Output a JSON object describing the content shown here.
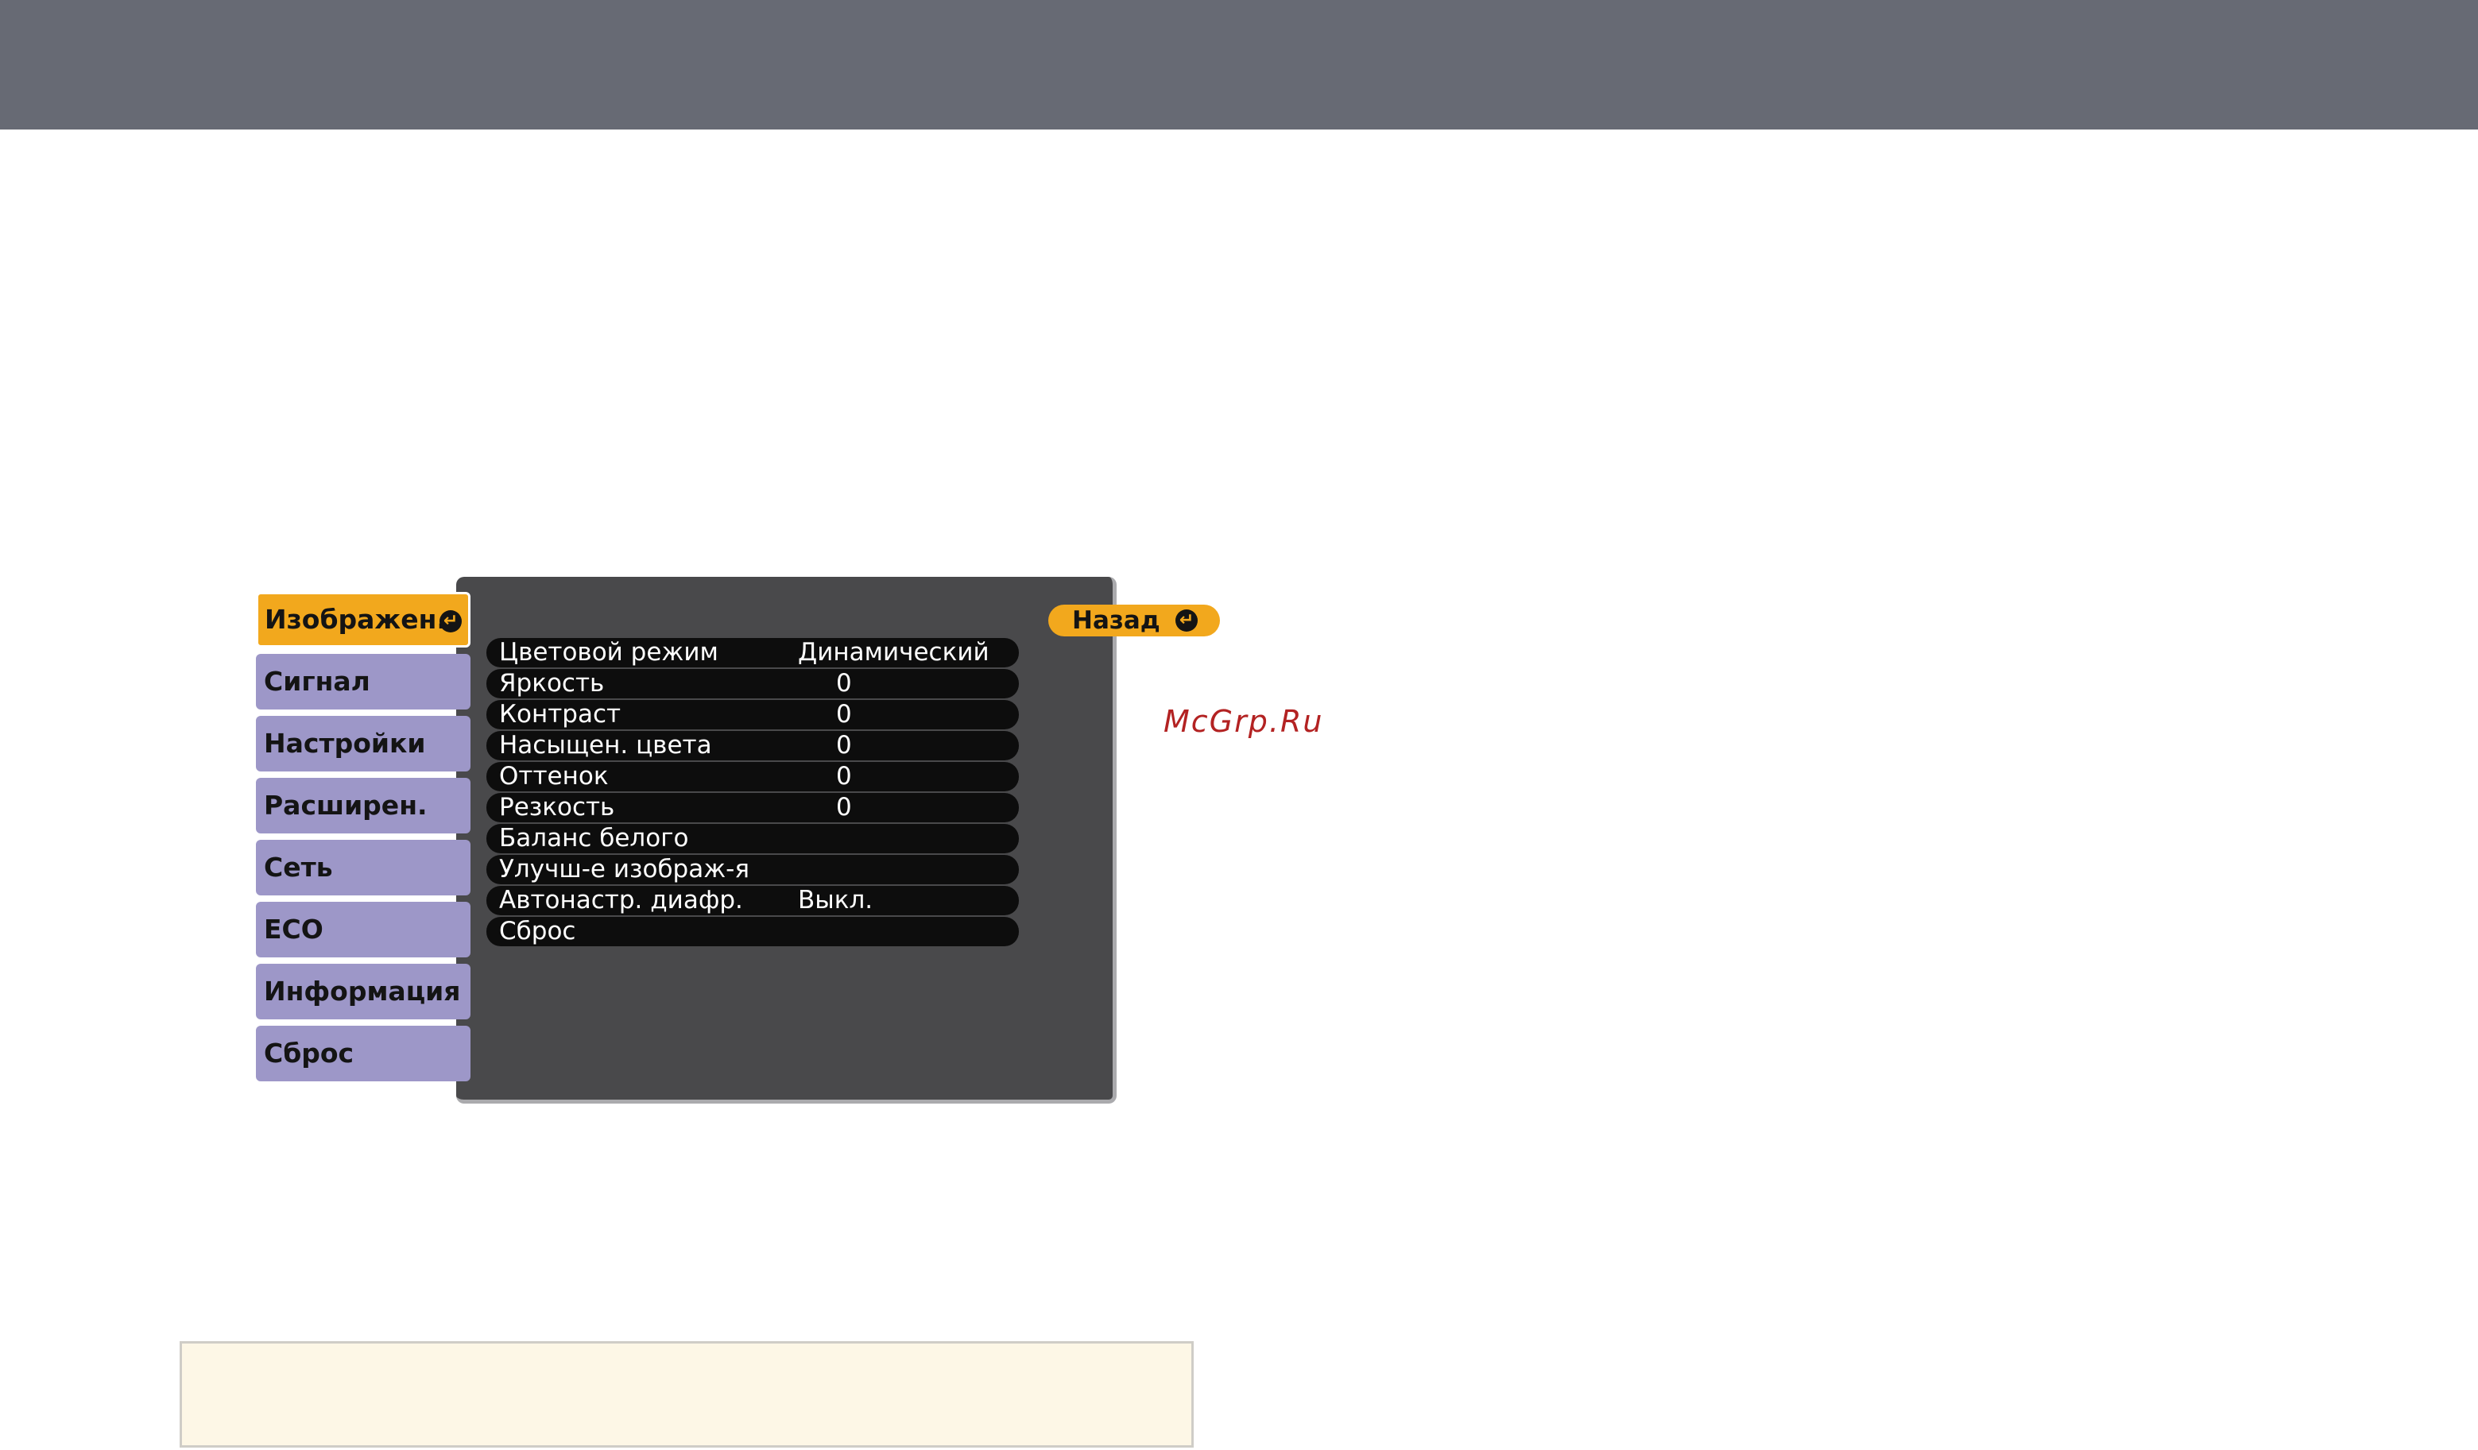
{
  "watermark": "McGrp.Ru",
  "menu": {
    "sidebar": [
      {
        "label": "Изображен.",
        "active": true
      },
      {
        "label": "Сигнал",
        "active": false
      },
      {
        "label": "Настройки",
        "active": false
      },
      {
        "label": "Расширен.",
        "active": false
      },
      {
        "label": "Сеть",
        "active": false
      },
      {
        "label": "ECO",
        "active": false
      },
      {
        "label": "Информация",
        "active": false
      },
      {
        "label": "Сброс",
        "active": false
      }
    ],
    "back_label": "Назад",
    "options": [
      {
        "label": "Цветовой режим",
        "value": "Динамический"
      },
      {
        "label": "Яркость",
        "value": "0"
      },
      {
        "label": "Контраст",
        "value": "0"
      },
      {
        "label": "Насыщен. цвета",
        "value": "0"
      },
      {
        "label": "Оттенок",
        "value": "0"
      },
      {
        "label": "Резкость",
        "value": "0"
      },
      {
        "label": "Баланс белого",
        "value": ""
      },
      {
        "label": "Улучш-е изображ-я",
        "value": ""
      },
      {
        "label": "Автонастр. диафр.",
        "value": "Выкл."
      },
      {
        "label": "Сброс",
        "value": ""
      }
    ]
  },
  "colors": {
    "top_bar": "#676a74",
    "accent": "#f2a81d",
    "sidebar_item": "#9d97c8",
    "panel": "#49494b",
    "note_box": "#fdf7e6",
    "watermark": "#b32222"
  },
  "icons": {
    "enter": "enter-icon"
  }
}
